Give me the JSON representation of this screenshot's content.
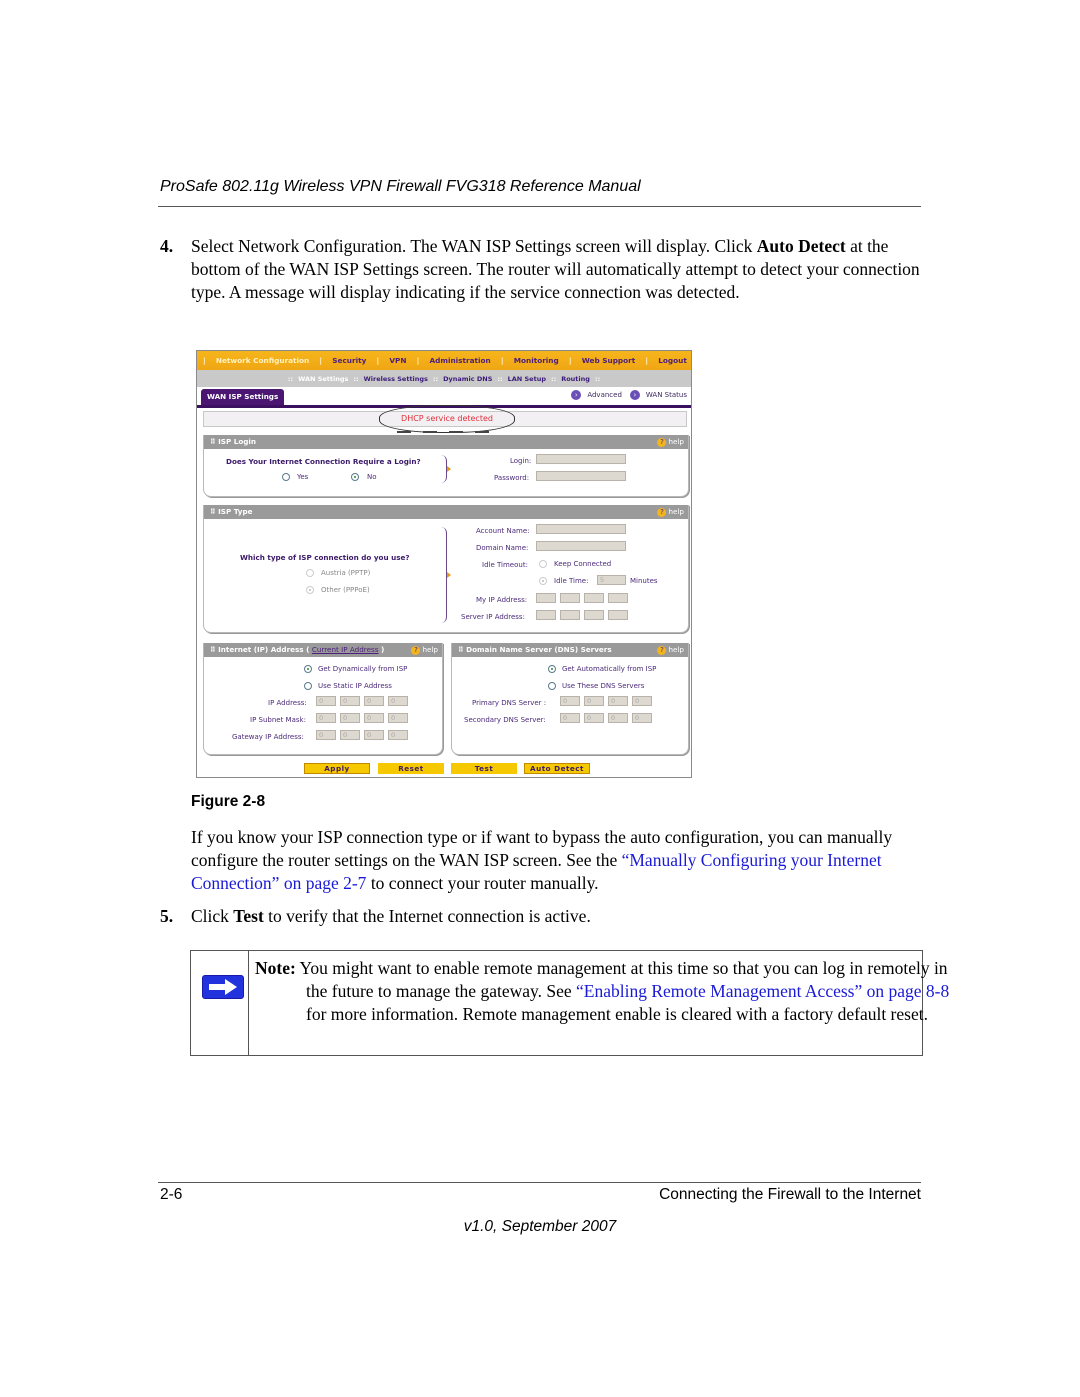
{
  "header": {
    "running_title": "ProSafe 802.11g Wireless VPN Firewall FVG318 Reference Manual"
  },
  "step4": {
    "number": "4.",
    "text_before": "Select Network Configuration. The WAN ISP Settings screen will display. Click ",
    "bold": "Auto Detect",
    "text_after": " at the bottom of the WAN ISP Settings screen. The router will automatically attempt to detect your connection type. A message will display indicating if the service connection was detected."
  },
  "figure": {
    "caption": "Figure 2-8",
    "top_nav": [
      "Network Configuration",
      "Security",
      "VPN",
      "Administration",
      "Monitoring",
      "Web Support",
      "Logout"
    ],
    "sub_nav": [
      "WAN Settings",
      "Wireless Settings",
      "Dynamic DNS",
      "LAN Setup",
      "Routing"
    ],
    "tab": "WAN ISP Settings",
    "tab_links": [
      "Advanced",
      "WAN Status"
    ],
    "message": "DHCP service detected",
    "help_label": "help",
    "isp_login": {
      "title": "ISP Login",
      "question": "Does Your Internet Connection Require a Login?",
      "options": [
        "Yes",
        "No"
      ],
      "selected": "No",
      "login_label": "Login:",
      "password_label": "Password:",
      "login_value": "",
      "password_value": ""
    },
    "isp_type": {
      "title": "ISP Type",
      "question": "Which type of ISP connection do you use?",
      "options": [
        "Austria (PPTP)",
        "Other (PPPoE)"
      ],
      "selected": "Other (PPPoE)",
      "account_name_label": "Account Name:",
      "domain_name_label": "Domain Name:",
      "idle_timeout_label": "Idle Timeout:",
      "keep_connected_label": "Keep Connected",
      "idle_time_label": "Idle Time:",
      "idle_time_value": "5",
      "minutes_label": "Minutes",
      "my_ip_label": "My IP Address:",
      "server_ip_label": "Server IP Address:"
    },
    "internet_ip": {
      "title": "Internet (IP) Address",
      "link": "Current IP Address",
      "options": [
        "Get Dynamically from ISP",
        "Use Static IP Address"
      ],
      "selected": "Get Dynamically from ISP",
      "ip_label": "IP Address:",
      "mask_label": "IP Subnet Mask:",
      "gateway_label": "Gateway IP Address:",
      "octet_value": "0"
    },
    "dns": {
      "title": "Domain Name Server (DNS) Servers",
      "options": [
        "Get Automatically from ISP",
        "Use These DNS Servers"
      ],
      "selected": "Get Automatically from ISP",
      "primary_label": "Primary DNS Server :",
      "secondary_label": "Secondary DNS Server:",
      "octet_value": "0"
    },
    "buttons": [
      "Apply",
      "Reset",
      "Test",
      "Auto Detect"
    ]
  },
  "paragraph": {
    "text_before": "If you know your ISP connection type or if want to bypass the auto configuration, you can manually configure the router settings on the WAN ISP screen. See the ",
    "link": "“Manually Configuring your Internet Connection” on page 2-7",
    "text_after": " to connect your router manually."
  },
  "step5": {
    "number": "5.",
    "text_before": "Click ",
    "bold": "Test",
    "text_after": " to verify that the Internet connection is active."
  },
  "note": {
    "label": "Note:",
    "text_before": " You might want to enable remote management at this time so that you can log in remotely in the future to manage the gateway. See ",
    "link": "“Enabling Remote Management Access” on page 8-8",
    "text_after": " for more information. Remote management enable is cleared with a factory default reset."
  },
  "footer": {
    "page_number": "2-6",
    "chapter": "Connecting the Firewall to the Internet",
    "version": "v1.0, September 2007"
  },
  "colors": {
    "link": "#1a1ad6",
    "nav_orange": "#f0a614",
    "tab_purple": "#4a1672",
    "message_red": "#e0303a",
    "button_yellow": "#f6c800"
  }
}
